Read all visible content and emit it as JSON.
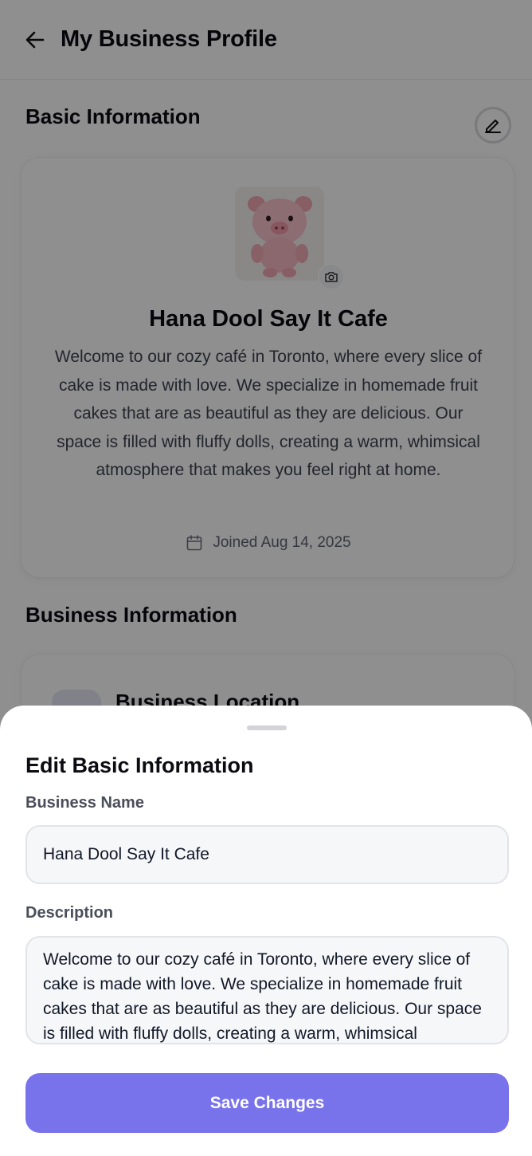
{
  "header": {
    "title": "My Business Profile",
    "back_icon": "arrow-left-icon"
  },
  "basic_section": {
    "heading": "Basic Information",
    "edit_icon": "pencil-icon"
  },
  "profile": {
    "avatar": "pig-plush-image",
    "camera_icon": "camera-icon",
    "name": "Hana Dool Say It Cafe",
    "description": "Welcome to our cozy café in Toronto, where every slice of cake is made with love. We specialize in homemade fruit cakes that are as beautiful as they are delicious. Our space is filled with fluffy dolls, creating a warm, whimsical atmosphere that makes you feel right at home.",
    "joined_icon": "calendar-icon",
    "joined": "Joined Aug 14, 2025"
  },
  "business_section": {
    "heading": "Business Information",
    "location_title": "Business Location"
  },
  "sheet": {
    "title": "Edit Basic Information",
    "name_label": "Business Name",
    "name_value": "Hana Dool Say It Cafe",
    "description_label": "Description",
    "description_value": "Welcome to our cozy café in Toronto, where every slice of cake is made with love. We specialize in homemade fruit cakes that are as beautiful as they are delicious. Our space is filled with fluffy dolls, creating a warm, whimsical atmosphere that makes you feel right at home.",
    "save_label": "Save Changes"
  },
  "colors": {
    "accent": "#7873ea",
    "scrim": "rgba(0,0,0,0.44)",
    "field_bg": "#f6f7f9"
  }
}
